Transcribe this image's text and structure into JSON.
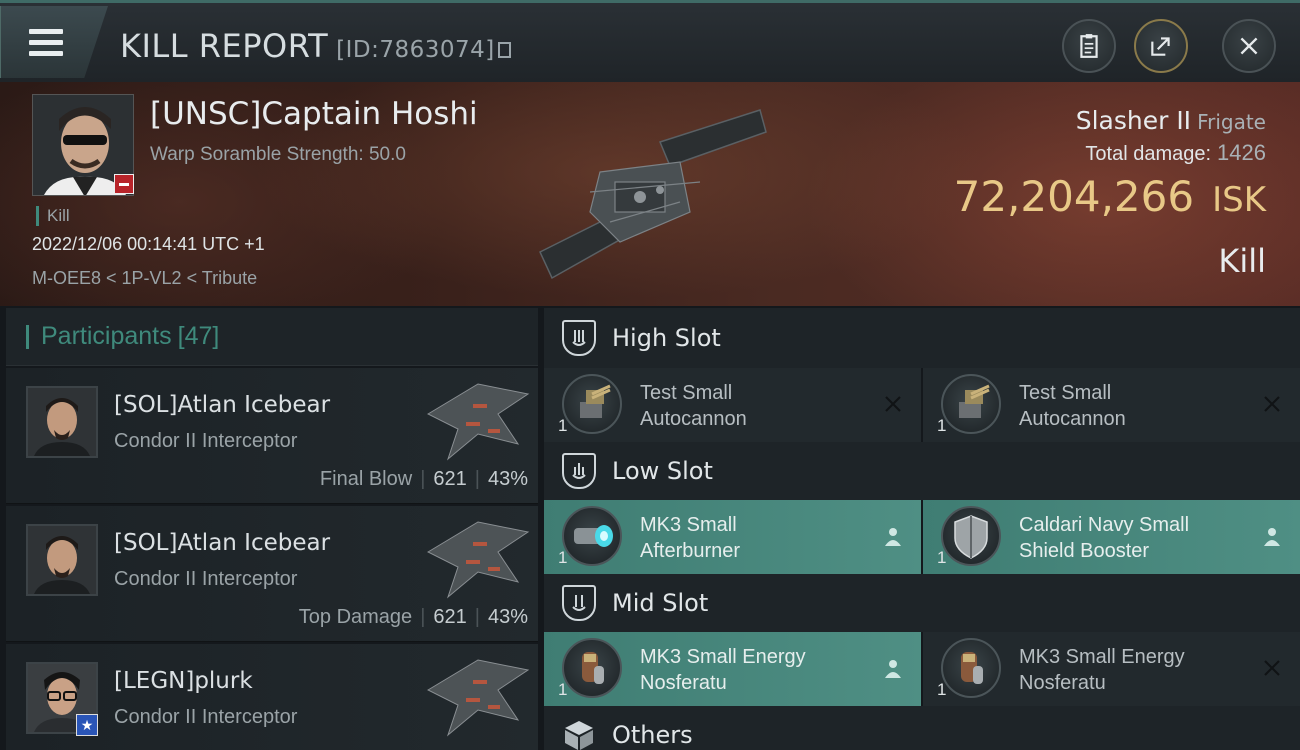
{
  "header": {
    "title": "KILL REPORT",
    "report_id": "[ID:7863074]",
    "icons": [
      "menu-icon",
      "copy-icon",
      "clipboard-icon",
      "share-icon",
      "close-icon"
    ]
  },
  "victim": {
    "name": "[UNSC]Captain Hoshi",
    "scramble": "Warp Soramble Strength: 50.0",
    "kill_tag": "Kill",
    "datetime": "2022/12/06 00:14:41 UTC +1",
    "location": "M-OEE8 < 1P-VL2 < Tribute",
    "ship_name": "Slasher II",
    "ship_class": "Frigate",
    "total_damage_label": "Total damage:",
    "total_damage": "1426",
    "isk_value": "72,204,266",
    "isk_unit": "ISK",
    "outcome": "Kill"
  },
  "participants": {
    "label": "Participants",
    "count": "[47]",
    "rows": [
      {
        "name": "[SOL]Atlan Icebear",
        "ship": "Condor II Interceptor",
        "role": "Final Blow",
        "damage": "621",
        "percent": "43%"
      },
      {
        "name": "[SOL]Atlan Icebear",
        "ship": "Condor II Interceptor",
        "role": "Top Damage",
        "damage": "621",
        "percent": "43%"
      },
      {
        "name": "[LEGN]plurk",
        "ship": "Condor II Interceptor",
        "role": "",
        "damage": "",
        "percent": ""
      }
    ]
  },
  "fittings": {
    "high": {
      "label": "High Slot",
      "modules": [
        {
          "qty": "1",
          "line1": "Test Small",
          "line2": "Autocannon",
          "state": "destroyed"
        },
        {
          "qty": "1",
          "line1": "Test Small",
          "line2": "Autocannon",
          "state": "destroyed"
        }
      ]
    },
    "low": {
      "label": "Low Slot",
      "modules": [
        {
          "qty": "1",
          "line1": "MK3 Small",
          "line2": "Afterburner",
          "state": "dropped"
        },
        {
          "qty": "1",
          "line1": "Caldari Navy Small",
          "line2": "Shield Booster",
          "state": "dropped"
        }
      ]
    },
    "mid": {
      "label": "Mid Slot",
      "modules": [
        {
          "qty": "1",
          "line1": "MK3 Small Energy",
          "line2": "Nosferatu",
          "state": "dropped"
        },
        {
          "qty": "1",
          "line1": "MK3 Small Energy",
          "line2": "Nosferatu",
          "state": "destroyed"
        }
      ]
    },
    "others": {
      "label": "Others"
    }
  },
  "colors": {
    "accent": "#3f8a7c",
    "isk": "#e8c887",
    "dropped_bg": "#4f8f84",
    "minus_badge": "#b8242a",
    "star_badge": "#2a55b7"
  }
}
